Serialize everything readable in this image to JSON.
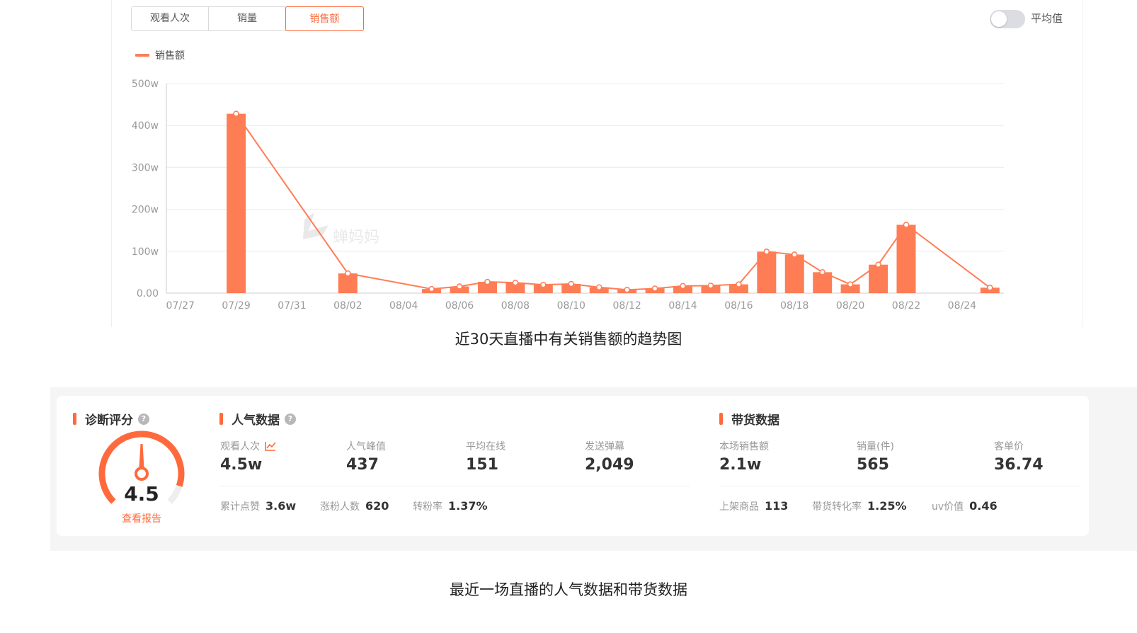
{
  "tabs": [
    {
      "label": "观看人次",
      "active": false
    },
    {
      "label": "销量",
      "active": false
    },
    {
      "label": "销售额",
      "active": true
    }
  ],
  "toggle": {
    "label": "平均值",
    "on": false
  },
  "watermark": "蝉妈妈",
  "colors": {
    "accent": "#ff6a3d",
    "bar": "#ff7d55",
    "line": "#ff7d55"
  },
  "chart_data": {
    "type": "bar",
    "legend": [
      "销售额"
    ],
    "legend_position": "top-left",
    "grid": true,
    "ylim": [
      0,
      500
    ],
    "y_ticks": [
      "0.00",
      "100w",
      "200w",
      "300w",
      "400w",
      "500w"
    ],
    "x_tick_labels": [
      "07/27",
      "07/29",
      "07/31",
      "08/02",
      "08/04",
      "08/06",
      "08/08",
      "08/10",
      "08/12",
      "08/14",
      "08/16",
      "08/18",
      "08/20",
      "08/22",
      "08/24"
    ],
    "dates": [
      "07/27",
      "07/28",
      "07/29",
      "07/30",
      "07/31",
      "08/01",
      "08/02",
      "08/03",
      "08/04",
      "08/05",
      "08/06",
      "08/07",
      "08/08",
      "08/09",
      "08/10",
      "08/11",
      "08/12",
      "08/13",
      "08/14",
      "08/15",
      "08/16",
      "08/17",
      "08/18",
      "08/19",
      "08/20",
      "08/21",
      "08/22",
      "08/23",
      "08/24",
      "08/25"
    ],
    "series": [
      {
        "name": "销售额",
        "unit": "w",
        "values": [
          null,
          null,
          428,
          null,
          null,
          null,
          47,
          null,
          null,
          10,
          16,
          27,
          25,
          20,
          22,
          14,
          8,
          11,
          17,
          18,
          21,
          99,
          92,
          50,
          21,
          68,
          163,
          null,
          null,
          13
        ]
      }
    ]
  },
  "caption_top": "近30天直播中有关销售额的趋势图",
  "diagnosis": {
    "title": "诊断评分",
    "score": "4.5",
    "score_value": 4.5,
    "score_max": 5,
    "link": "查看报告"
  },
  "popularity": {
    "title": "人气数据",
    "metrics": [
      {
        "label": "观看人次",
        "value": "4.5w"
      },
      {
        "label": "人气峰值",
        "value": "437"
      },
      {
        "label": "平均在线",
        "value": "151"
      },
      {
        "label": "发送弹幕",
        "value": "2,049"
      }
    ],
    "sub": [
      {
        "label": "累计点赞",
        "value": "3.6w"
      },
      {
        "label": "涨粉人数",
        "value": "620"
      },
      {
        "label": "转粉率",
        "value": "1.37%"
      }
    ]
  },
  "sales": {
    "title": "带货数据",
    "metrics": [
      {
        "label": "本场销售额",
        "value": "2.1w"
      },
      {
        "label": "销量(件)",
        "value": "565"
      },
      {
        "label": "客单价",
        "value": "36.74"
      }
    ],
    "sub": [
      {
        "label": "上架商品",
        "value": "113"
      },
      {
        "label": "带货转化率",
        "value": "1.25%"
      },
      {
        "label": "uv价值",
        "value": "0.46"
      }
    ]
  },
  "caption_bottom": "最近一场直播的人气数据和带货数据"
}
